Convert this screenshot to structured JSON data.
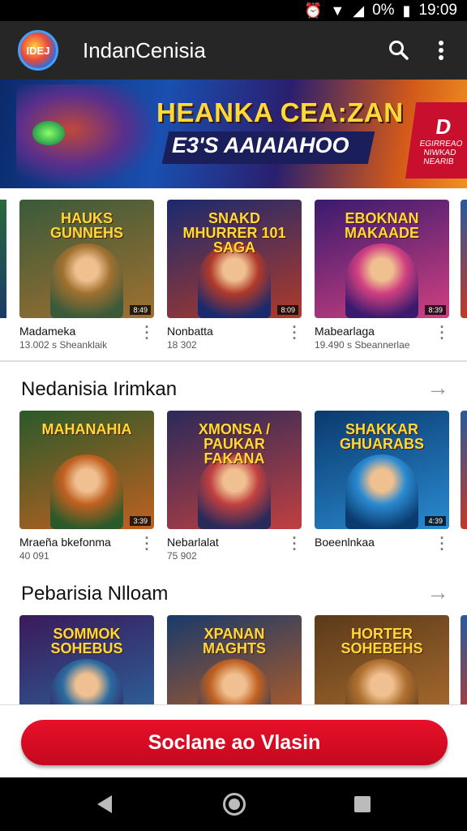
{
  "status_bar": {
    "battery": "0%",
    "time": "19:09"
  },
  "app_bar": {
    "logo_text": "IDEJ",
    "title": "IndanCenisia",
    "search_icon": "search-icon",
    "menu_icon": "more-vert-icon"
  },
  "banner": {
    "headline": "HEANKA CEA:ZAN",
    "subline": "E3'S AAIAIAHOO",
    "badge_letter": "D",
    "badge_text": "EGIRREAO NIWKAD NEARIB"
  },
  "row1": [
    {
      "thumb_text": "HAUKS GUNNEHS",
      "duration": "8:49",
      "title": "Madameka",
      "subtitle": "13.002 s Sheanklaik",
      "colors": [
        "#3a5a3a",
        "#a07030"
      ]
    },
    {
      "thumb_text": "SNAKD MHURRER 101 SAGA",
      "duration": "8:09",
      "title": "Nonbatta",
      "subtitle": "18 302",
      "colors": [
        "#1a2a6e",
        "#b03a2a"
      ]
    },
    {
      "thumb_text": "EBOKNAN MAKAADE",
      "duration": "8:39",
      "title": "Mabearlaga",
      "subtitle": "19.490 s Sbeannerlae",
      "colors": [
        "#3a1a6e",
        "#d04080"
      ]
    }
  ],
  "section2": {
    "title": "Nedanisia Irimkan",
    "arrow": "→"
  },
  "row2": [
    {
      "thumb_text": "MAHANAHIA",
      "duration": "3:39",
      "title": "Mraeña bkefonma",
      "subtitle": "40 091",
      "colors": [
        "#2a5a2a",
        "#c06020"
      ]
    },
    {
      "thumb_text": "XMONSA / PAUKAR FAKANA",
      "duration": "",
      "title": "Nebarlalat",
      "subtitle": "75 902",
      "colors": [
        "#2a2a5a",
        "#c04040"
      ]
    },
    {
      "thumb_text": "SHAKKAR GHUARABS",
      "duration": "4:39",
      "title": "Boeenlnkaa",
      "subtitle": "",
      "colors": [
        "#0a3a6e",
        "#2a8ad0"
      ]
    }
  ],
  "section3": {
    "title": "Pebarisia Nlloam",
    "arrow": "→"
  },
  "row3": [
    {
      "thumb_text": "SOMMOK SOHEBUS",
      "title": "",
      "subtitle": "",
      "colors": [
        "#3a1a5a",
        "#2a6aa0"
      ]
    },
    {
      "thumb_text": "XPANAN MAGHTS",
      "title": "",
      "subtitle": "",
      "colors": [
        "#1a3a6a",
        "#c06020"
      ]
    },
    {
      "thumb_text": "HORTER SOHEBEHS",
      "title": "",
      "subtitle": "",
      "colors": [
        "#5a3a1a",
        "#b07030"
      ]
    }
  ],
  "cta": {
    "label": "Soclane ao Vlasin"
  },
  "nav": {
    "back_icon": "back-icon",
    "home_icon": "home-icon",
    "recents_icon": "recents-icon"
  }
}
